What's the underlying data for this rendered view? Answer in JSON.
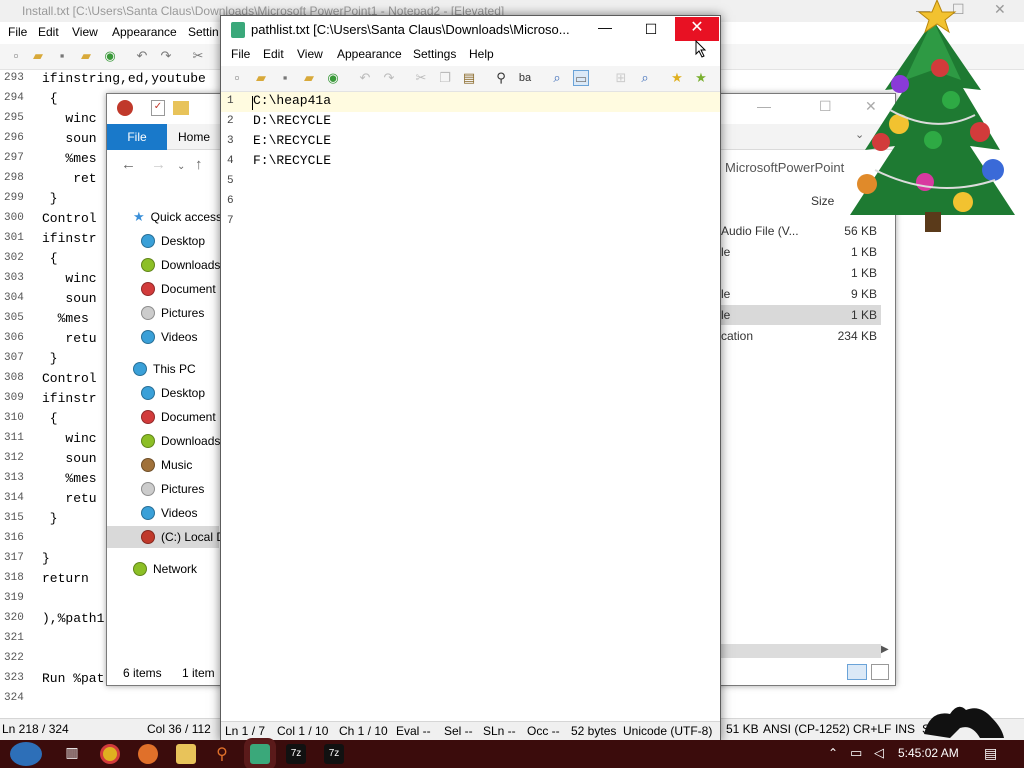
{
  "bg_notepad": {
    "title": "Install.txt [C:\\Users\\Santa Claus\\Downloads\\Microsoft PowerPoint1 - Notepad2 - [Elevated]",
    "menu": [
      "File",
      "Edit",
      "View",
      "Appearance",
      "Settin"
    ],
    "lines": [
      {
        "n": "293",
        "t": "ifinstring,ed,youtube"
      },
      {
        "n": "294",
        "t": " {"
      },
      {
        "n": "295",
        "t": "   winc"
      },
      {
        "n": "296",
        "t": "   soun"
      },
      {
        "n": "297",
        "t": "   %mes"
      },
      {
        "n": "298",
        "t": "    ret"
      },
      {
        "n": "299",
        "t": " }"
      },
      {
        "n": "300",
        "t": "Control"
      },
      {
        "n": "301",
        "t": "ifinstr"
      },
      {
        "n": "302",
        "t": " {"
      },
      {
        "n": "303",
        "t": "   winc"
      },
      {
        "n": "304",
        "t": "   soun"
      },
      {
        "n": "305",
        "t": "  %mes"
      },
      {
        "n": "306",
        "t": "   retu"
      },
      {
        "n": "307",
        "t": " }"
      },
      {
        "n": "308",
        "t": "Control"
      },
      {
        "n": "309",
        "t": "ifinstr"
      },
      {
        "n": "310",
        "t": " {"
      },
      {
        "n": "311",
        "t": "   winc"
      },
      {
        "n": "312",
        "t": "   soun"
      },
      {
        "n": "313",
        "t": "   %mes"
      },
      {
        "n": "314",
        "t": "   retu"
      },
      {
        "n": "315",
        "t": " }"
      },
      {
        "n": "316",
        "t": ""
      },
      {
        "n": "317",
        "t": "}"
      },
      {
        "n": "318",
        "t": "return"
      },
      {
        "n": "319",
        "t": ""
      },
      {
        "n": "320",
        "t": "),%path1"
      },
      {
        "n": "321",
        "t": ""
      },
      {
        "n": "322",
        "t": ""
      },
      {
        "n": "323",
        "t": "Run %pat"
      },
      {
        "n": "324",
        "t": ""
      }
    ],
    "status_ln": "Ln 218 / 324",
    "status_col": "Col 36 / 112",
    "status_size": "51 KB",
    "status_enc": "ANSI (CP-1252)",
    "status_eol": "CR+LF",
    "status_ins": "INS",
    "status_std": "STD"
  },
  "explorer": {
    "tabs": {
      "file": "File",
      "home": "Home"
    },
    "quick_access": "Quick access",
    "quick_items": [
      {
        "label": "Desktop",
        "color": "#3aa0d8"
      },
      {
        "label": "Downloads",
        "color": "#8cbf26"
      },
      {
        "label": "Document",
        "color": "#d23b3b"
      },
      {
        "label": "Pictures",
        "color": "#cccccc"
      },
      {
        "label": "Videos",
        "color": "#3aa0d8"
      }
    ],
    "this_pc": "This PC",
    "pc_items": [
      {
        "label": "Desktop",
        "color": "#3aa0d8"
      },
      {
        "label": "Document",
        "color": "#d23b3b"
      },
      {
        "label": "Downloads",
        "color": "#8cbf26"
      },
      {
        "label": "Music",
        "color": "#a0713a"
      },
      {
        "label": "Pictures",
        "color": "#cccccc"
      },
      {
        "label": "Videos",
        "color": "#3aa0d8"
      },
      {
        "label": "(C:) Local D",
        "color": "#c0392b"
      }
    ],
    "network": "Network",
    "items_count": "6 items",
    "selected_count": "1 item",
    "folder_name": "MicrosoftPowerPoint",
    "size_header": "Size",
    "rows": [
      {
        "type": "Audio File (V...",
        "size": "56 KB"
      },
      {
        "type": "le",
        "size": "1 KB"
      },
      {
        "type": "",
        "size": "1 KB"
      },
      {
        "type": "le",
        "size": "9 KB"
      },
      {
        "type": "le",
        "size": "1 KB"
      },
      {
        "type": "cation",
        "size": "234 KB"
      }
    ]
  },
  "main": {
    "title": "pathlist.txt [C:\\Users\\Santa Claus\\Downloads\\Microso...",
    "menu": [
      "File",
      "Edit",
      "View",
      "Appearance",
      "Settings",
      "Help"
    ],
    "lines": [
      {
        "n": "1",
        "t": "C:\\heap41a"
      },
      {
        "n": "2",
        "t": "D:\\RECYCLE"
      },
      {
        "n": "3",
        "t": "E:\\RECYCLE"
      },
      {
        "n": "4",
        "t": "F:\\RECYCLE"
      },
      {
        "n": "5",
        "t": ""
      },
      {
        "n": "6",
        "t": ""
      },
      {
        "n": "7",
        "t": ""
      }
    ],
    "status": {
      "ln": "Ln 1 / 7",
      "col": "Col 1 / 10",
      "ch": "Ch 1 / 10",
      "eval": "Eval  --",
      "sel": "Sel  --",
      "sln": "SLn  --",
      "occ": "Occ  --",
      "bytes": "52 bytes",
      "enc": "Unicode (UTF-8)"
    }
  },
  "taskbar": {
    "clock": "5:45:02 AM",
    "items": [
      "start",
      "chrome",
      "firefox",
      "explorer",
      "search",
      "notepad2",
      "7z",
      "7z"
    ]
  }
}
